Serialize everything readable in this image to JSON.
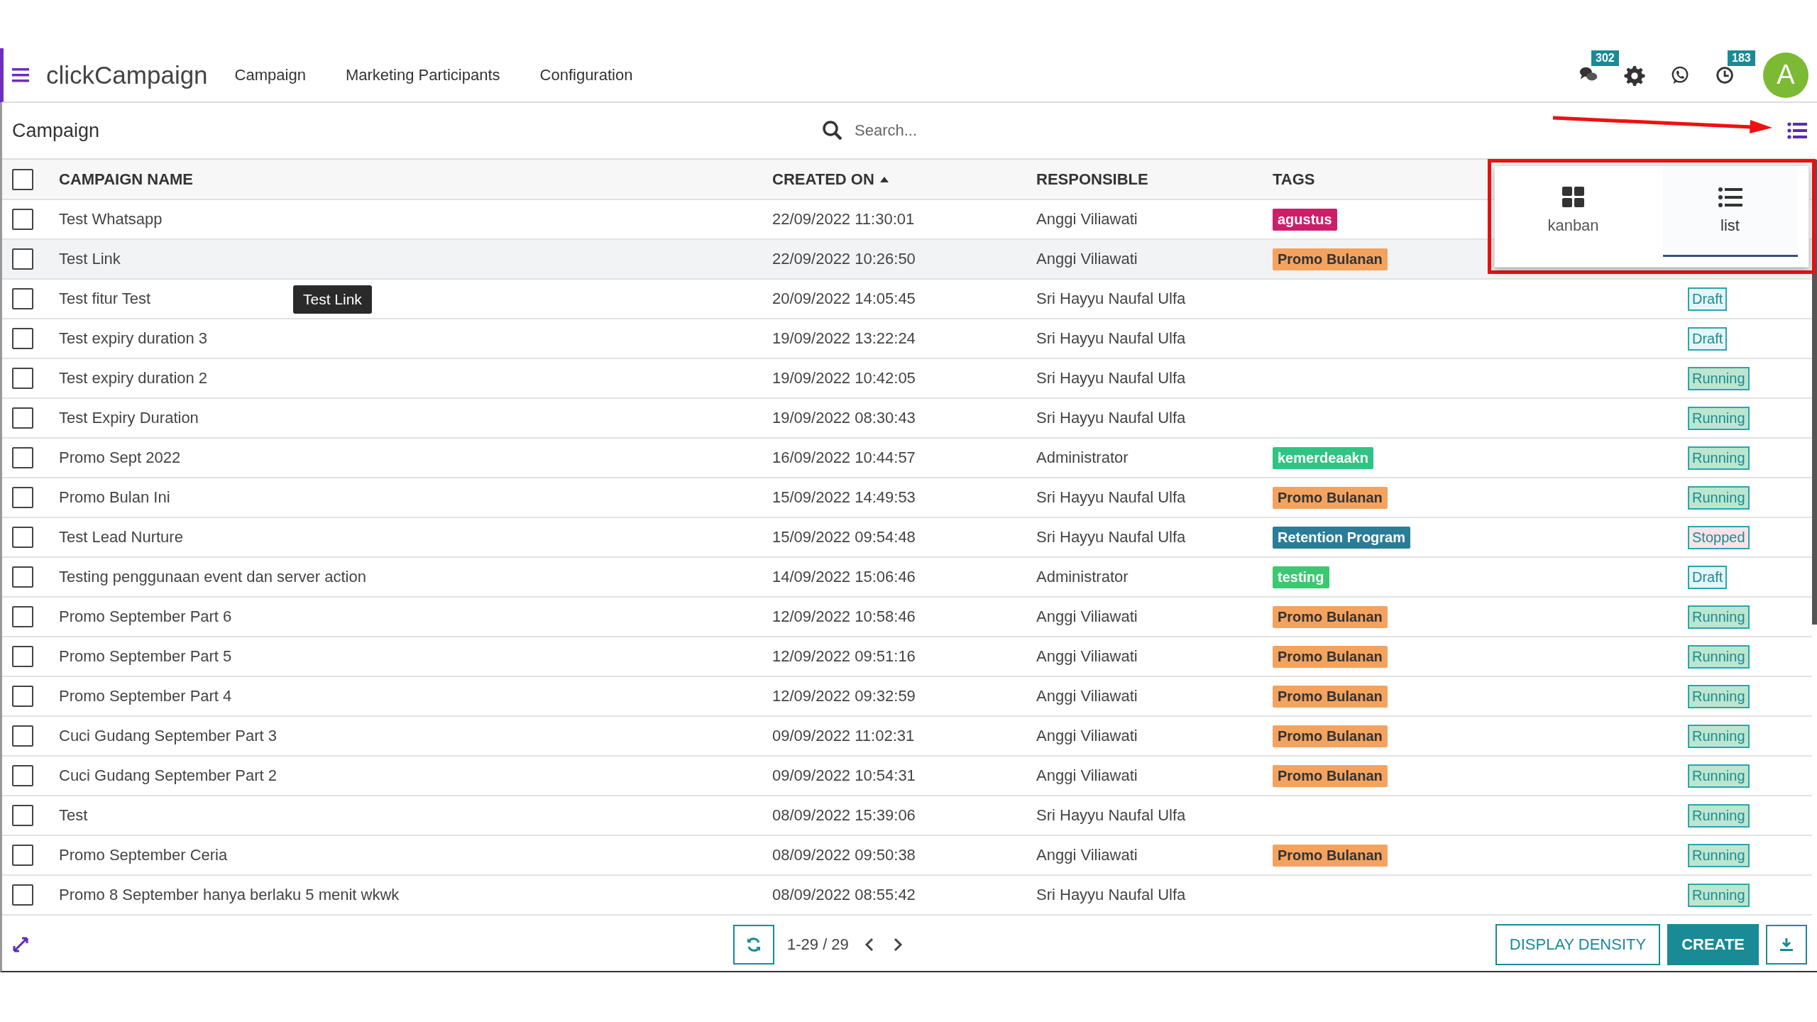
{
  "navbar": {
    "brand": "clickCampaign",
    "menu": [
      "Campaign",
      "Marketing Participants",
      "Configuration"
    ],
    "badges": [
      {
        "kind": "chat",
        "count": "302"
      },
      {
        "kind": "settings"
      },
      {
        "kind": "whatsapp"
      },
      {
        "kind": "activity",
        "count": "183"
      }
    ],
    "avatar": "A"
  },
  "control_panel": {
    "title": "Campaign",
    "search": {
      "placeholder": "Search..."
    }
  },
  "view_switcher": {
    "options": [
      {
        "kind": "kanban",
        "label": "kanban",
        "selected": false
      },
      {
        "kind": "list",
        "label": "list",
        "selected": true
      }
    ]
  },
  "table": {
    "select_all": {
      "checked": false
    },
    "columns": [
      {
        "label": "CAMPAIGN NAME",
        "sorted": false
      },
      {
        "label": "CREATED ON",
        "sorted": true
      },
      {
        "label": "RESPONSIBLE",
        "sorted": false
      },
      {
        "label": "TAGS",
        "sorted": false
      }
    ],
    "rows": [
      {
        "checked": false,
        "highlighted": false,
        "name": "Test Whatsapp",
        "created_on": "22/09/2022 11:30:01",
        "responsible": "Anggi Viliawati",
        "tag": {
          "label": "agustus",
          "color": "#cc1f6a"
        }
      },
      {
        "checked": false,
        "highlighted": true,
        "name": "Test Link",
        "created_on": "22/09/2022 10:26:50",
        "responsible": "Anggi Viliawati",
        "tag": {
          "label": "Promo Bulanan",
          "color": "#f4a35f"
        }
      },
      {
        "checked": false,
        "highlighted": false,
        "name": "Test fitur Test",
        "tooltip": "Test Link",
        "created_on": "20/09/2022 14:05:45",
        "responsible": "Sri Hayyu Naufal Ulfa",
        "status": {
          "label": "Draft",
          "color": "#e4f6fa"
        }
      },
      {
        "checked": false,
        "highlighted": false,
        "name": "Test expiry duration 3",
        "created_on": "19/09/2022 13:22:24",
        "responsible": "Sri Hayyu Naufal Ulfa",
        "status": {
          "label": "Draft",
          "color": "#e4f6fa"
        }
      },
      {
        "checked": false,
        "highlighted": false,
        "name": "Test expiry duration 2",
        "created_on": "19/09/2022 10:42:05",
        "responsible": "Sri Hayyu Naufal Ulfa",
        "status": {
          "label": "Running",
          "color": "#bce6cf"
        }
      },
      {
        "checked": false,
        "highlighted": false,
        "name": "Test Expiry Duration",
        "created_on": "19/09/2022 08:30:43",
        "responsible": "Sri Hayyu Naufal Ulfa",
        "status": {
          "label": "Running",
          "color": "#bce6cf"
        }
      },
      {
        "checked": false,
        "highlighted": false,
        "name": "Promo Sept 2022",
        "created_on": "16/09/2022 10:44:57",
        "responsible": "Administrator",
        "tag": {
          "label": "kemerdeaakn",
          "color": "#2fc482"
        },
        "status": {
          "label": "Running",
          "color": "#bce6cf"
        }
      },
      {
        "checked": false,
        "highlighted": false,
        "name": "Promo Bulan Ini",
        "created_on": "15/09/2022 14:49:53",
        "responsible": "Sri Hayyu Naufal Ulfa",
        "tag": {
          "label": "Promo Bulanan",
          "color": "#f4a35f"
        },
        "status": {
          "label": "Running",
          "color": "#bce6cf"
        }
      },
      {
        "checked": false,
        "highlighted": false,
        "name": "Test Lead Nurture",
        "created_on": "15/09/2022 09:54:48",
        "responsible": "Sri Hayyu Naufal Ulfa",
        "tag": {
          "label": "Retention Program",
          "color": "#2a7d98"
        },
        "status": {
          "label": "Stopped",
          "color": "#fbe3e7"
        }
      },
      {
        "checked": false,
        "highlighted": false,
        "name": "Testing penggunaan event dan server action",
        "created_on": "14/09/2022 15:06:46",
        "responsible": "Administrator",
        "tag": {
          "label": "testing",
          "color": "#3cc870"
        },
        "status": {
          "label": "Draft",
          "color": "#e4f6fa"
        }
      },
      {
        "checked": false,
        "highlighted": false,
        "name": "Promo September Part 6",
        "created_on": "12/09/2022 10:58:46",
        "responsible": "Anggi Viliawati",
        "tag": {
          "label": "Promo Bulanan",
          "color": "#f4a35f"
        },
        "status": {
          "label": "Running",
          "color": "#bce6cf"
        }
      },
      {
        "checked": false,
        "highlighted": false,
        "name": "Promo September Part 5",
        "created_on": "12/09/2022 09:51:16",
        "responsible": "Anggi Viliawati",
        "tag": {
          "label": "Promo Bulanan",
          "color": "#f4a35f"
        },
        "status": {
          "label": "Running",
          "color": "#bce6cf"
        }
      },
      {
        "checked": false,
        "highlighted": false,
        "name": "Promo September Part 4",
        "created_on": "12/09/2022 09:32:59",
        "responsible": "Anggi Viliawati",
        "tag": {
          "label": "Promo Bulanan",
          "color": "#f4a35f"
        },
        "status": {
          "label": "Running",
          "color": "#bce6cf"
        }
      },
      {
        "checked": false,
        "highlighted": false,
        "name": "Cuci Gudang September Part 3",
        "created_on": "09/09/2022 11:02:31",
        "responsible": "Anggi Viliawati",
        "tag": {
          "label": "Promo Bulanan",
          "color": "#f4a35f"
        },
        "status": {
          "label": "Running",
          "color": "#bce6cf"
        }
      },
      {
        "checked": false,
        "highlighted": false,
        "name": "Cuci Gudang September Part 2",
        "created_on": "09/09/2022 10:54:31",
        "responsible": "Anggi Viliawati",
        "tag": {
          "label": "Promo Bulanan",
          "color": "#f4a35f"
        },
        "status": {
          "label": "Running",
          "color": "#bce6cf"
        }
      },
      {
        "checked": false,
        "highlighted": false,
        "name": "Test",
        "created_on": "08/09/2022 15:39:06",
        "responsible": "Sri Hayyu Naufal Ulfa",
        "status": {
          "label": "Running",
          "color": "#bce6cf"
        }
      },
      {
        "checked": false,
        "highlighted": false,
        "name": "Promo September Ceria",
        "created_on": "08/09/2022 09:50:38",
        "responsible": "Anggi Viliawati",
        "tag": {
          "label": "Promo Bulanan",
          "color": "#f4a35f"
        },
        "status": {
          "label": "Running",
          "color": "#bce6cf"
        }
      },
      {
        "checked": false,
        "highlighted": false,
        "name": "Promo 8 September hanya berlaku 5 menit wkwk",
        "created_on": "08/09/2022 08:55:42",
        "responsible": "Sri Hayyu Naufal Ulfa",
        "status": {
          "label": "Running",
          "color": "#bce6cf"
        }
      }
    ]
  },
  "footer": {
    "pager": "1-29 / 29",
    "buttons": [
      {
        "kind": "outline",
        "label": "DISPLAY DENSITY"
      },
      {
        "kind": "primary",
        "label": "CREATE"
      }
    ]
  }
}
